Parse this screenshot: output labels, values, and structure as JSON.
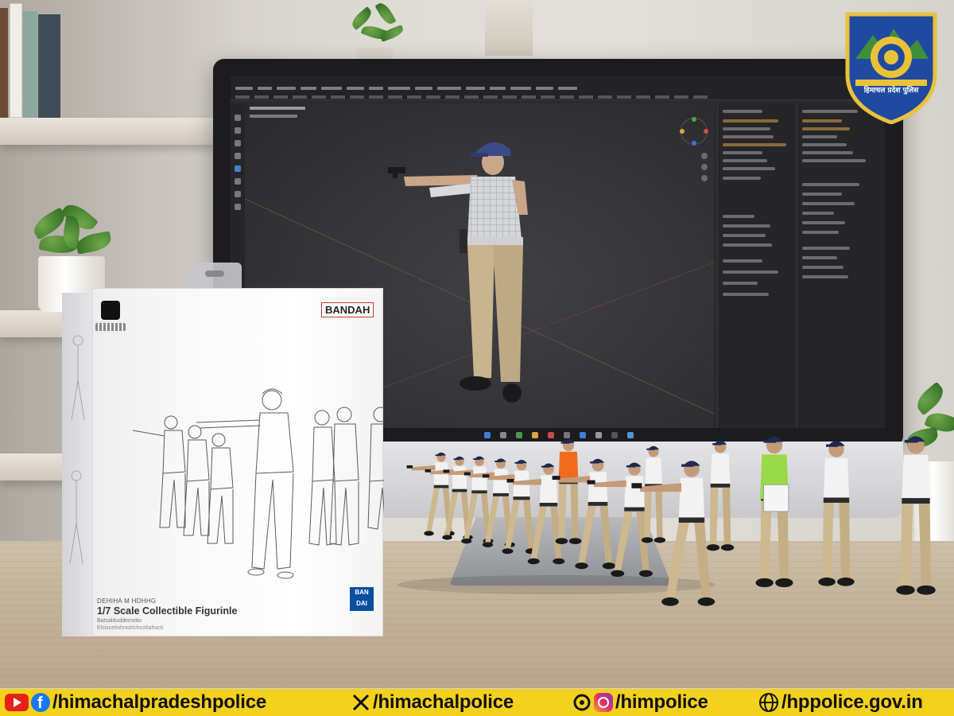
{
  "logo": {
    "badge_text": "हिमाचल प्रदेश पुलिस",
    "colors": {
      "shield": "#1f4aa0",
      "gold": "#e9c23b",
      "green": "#3f8f3a"
    }
  },
  "monitor": {
    "app": "3d-modeling-software",
    "viewport_model": "police-officer-figure-aiming-pistol"
  },
  "package": {
    "brand_label": "BANDAH",
    "small_line": "DEHIHA M HDHHG",
    "title": "1/7 Scale Collectible Figurinle",
    "fine_print_1": "Batsalduddemotio",
    "fine_print_2": "Elsiscetivhnstrichcoltahucti",
    "corner_mark": "BAN DAI",
    "illustration": "line-drawing-of-officers-in-shooting-drill"
  },
  "foreground": {
    "scene": "miniature-police-figurines-in-shooting-drill",
    "uniform_colors": {
      "shirt": "#f2f2f2",
      "trousers": "#cdb88f",
      "cap": "#1d2a52",
      "vest_orange": "#f06b1e",
      "vest_green": "#9ad94a"
    }
  },
  "footer": {
    "background": "#f4d11c",
    "youtube_facebook": "/himachalpradeshpolice",
    "x": "/himachalpolice",
    "threads_instagram": "/himpolice",
    "website": "hppolice.gov.in",
    "website_prefix": "/"
  }
}
